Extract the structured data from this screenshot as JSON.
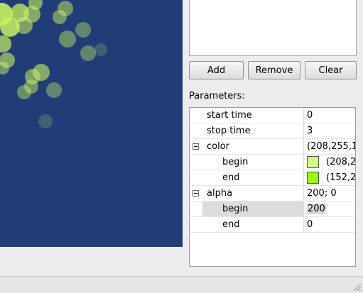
{
  "colors": {
    "preview_bg": "#213d78",
    "particle": "#c8f060",
    "swatch_begin": "#d0ff80",
    "swatch_end": "#98ff00"
  },
  "buttons": {
    "add": "Add",
    "remove": "Remove",
    "clear": "Clear"
  },
  "parameters_label": "Parameters:",
  "tree": {
    "rows": [
      {
        "name": "start time",
        "value": "0"
      },
      {
        "name": "stop time",
        "value": "3"
      },
      {
        "name": "color",
        "value": "(208,255,1"
      },
      {
        "name": "begin",
        "value": "(208,2"
      },
      {
        "name": "end",
        "value": "(152,2"
      },
      {
        "name": "alpha",
        "value": "200; 0"
      },
      {
        "name": "begin",
        "value": "200"
      },
      {
        "name": "end",
        "value": "0"
      }
    ]
  },
  "icons": {
    "expander": "collapse-minus-icon",
    "grip": "resize-grip-icon"
  }
}
